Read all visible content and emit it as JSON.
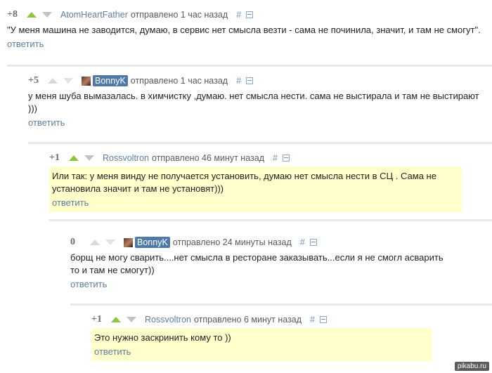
{
  "comments": [
    {
      "score": "+8",
      "author": "AtomHeartFather",
      "sent": "отправлено 1 час назад",
      "hash": "#",
      "text": "\"У меня машина не заводится, думаю, в сервис нет смысла везти - сама не починила, значит, и там не смогут\".",
      "reply": "ответить"
    },
    {
      "score": "+5",
      "author": "BonnyK",
      "sent": "отправлено 1 час назад",
      "hash": "#",
      "text": "у меня шуба вымазалась. в химчистку ,думаю. нет смысла нести. сама не выстирала и там не выстирают\n)))",
      "reply": "ответить"
    },
    {
      "score": "+1",
      "author": "Rossvoltron",
      "sent": "отправлено 46 минут назад",
      "hash": "#",
      "text": "Или так: у меня винду не получается установить, думаю нет смысла нести в СЦ . Сама не\nустановила значит и там не установят)))",
      "reply": "ответить"
    },
    {
      "score": "0",
      "author": "BonnyK",
      "sent": "отправлено 24 минуты назад",
      "hash": "#",
      "text": "борщ не могу сварить....нет смысла в ресторане заказывать...если я не смогл асварить\n то и там не смогут))",
      "reply": "ответить"
    },
    {
      "score": "+1",
      "author": "Rossvoltron",
      "sent": "отправлено 6 минут назад",
      "hash": "#",
      "text": "Это нужно заскринить кому то ))",
      "reply": "ответить"
    }
  ],
  "watermark": "pikabu.ru"
}
